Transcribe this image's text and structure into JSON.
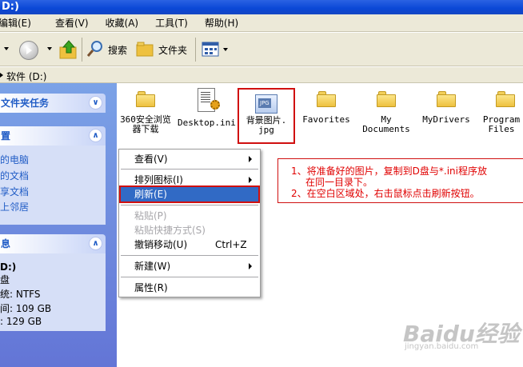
{
  "window": {
    "title": "D:)"
  },
  "menu": [
    "编辑(E)",
    "查看(V)",
    "收藏(A)",
    "工具(T)",
    "帮助(H)"
  ],
  "toolbar": {
    "search_label": "搜索",
    "folders_label": "文件夹"
  },
  "address": {
    "value": "软件 (D:)"
  },
  "tasks_panel": {
    "title": "文件夹任务"
  },
  "places_panel": {
    "title": "置",
    "links": [
      "的电脑",
      "的文档",
      "享文档",
      "上邻居"
    ]
  },
  "details_panel": {
    "title": "息",
    "lines": [
      "D:)",
      "盘",
      "统: NTFS",
      "间: 109 GB",
      ": 129 GB"
    ]
  },
  "files": [
    {
      "name": "360安全浏览器下载",
      "line1": "360安全浏览",
      "line2": "器下载",
      "icon": "folder-icon"
    },
    {
      "name": "Desktop.ini",
      "line1": "Desktop.ini",
      "line2": "",
      "icon": "ini-file-icon"
    },
    {
      "name": "背景图片.jpg",
      "line1": "背景图片.",
      "line2": "jpg",
      "icon": "jpg-file-icon",
      "badge": "JPG"
    },
    {
      "name": "Favorites",
      "line1": "Favorites",
      "line2": "",
      "icon": "folder-icon"
    },
    {
      "name": "My Documents",
      "line1": "My",
      "line2": "Documents",
      "icon": "folder-icon"
    },
    {
      "name": "MyDrivers",
      "line1": "MyDrivers",
      "line2": "",
      "icon": "folder-icon"
    },
    {
      "name": "Program Files",
      "line1": "Program",
      "line2": "Files",
      "icon": "folder-icon"
    }
  ],
  "context_menu": {
    "items": [
      {
        "label": "查看(V)",
        "submenu": true
      },
      {
        "label": "排列图标(I)",
        "submenu": true
      },
      {
        "label": "刷新(E)",
        "highlighted": true
      },
      {
        "label": "粘贴(P)",
        "disabled": true
      },
      {
        "label": "粘贴快捷方式(S)",
        "disabled": true
      },
      {
        "label": "撤销移动(U)",
        "shortcut": "Ctrl+Z"
      },
      {
        "label": "新建(W)",
        "submenu": true
      },
      {
        "label": "属性(R)"
      }
    ]
  },
  "annotation": {
    "line1": "1、将准备好的图片，复制到D盘与*.ini程序放",
    "line1b": "在同一目录下。",
    "line2": "2、在空白区域处，右击鼠标点击刷新按钮。"
  },
  "watermark": {
    "text": "Baidu经验",
    "sub": "jingyan.baidu.com"
  },
  "colors": {
    "accent": "#316ac5",
    "annotation": "#e00000",
    "titlebar": "#0a47d6"
  }
}
